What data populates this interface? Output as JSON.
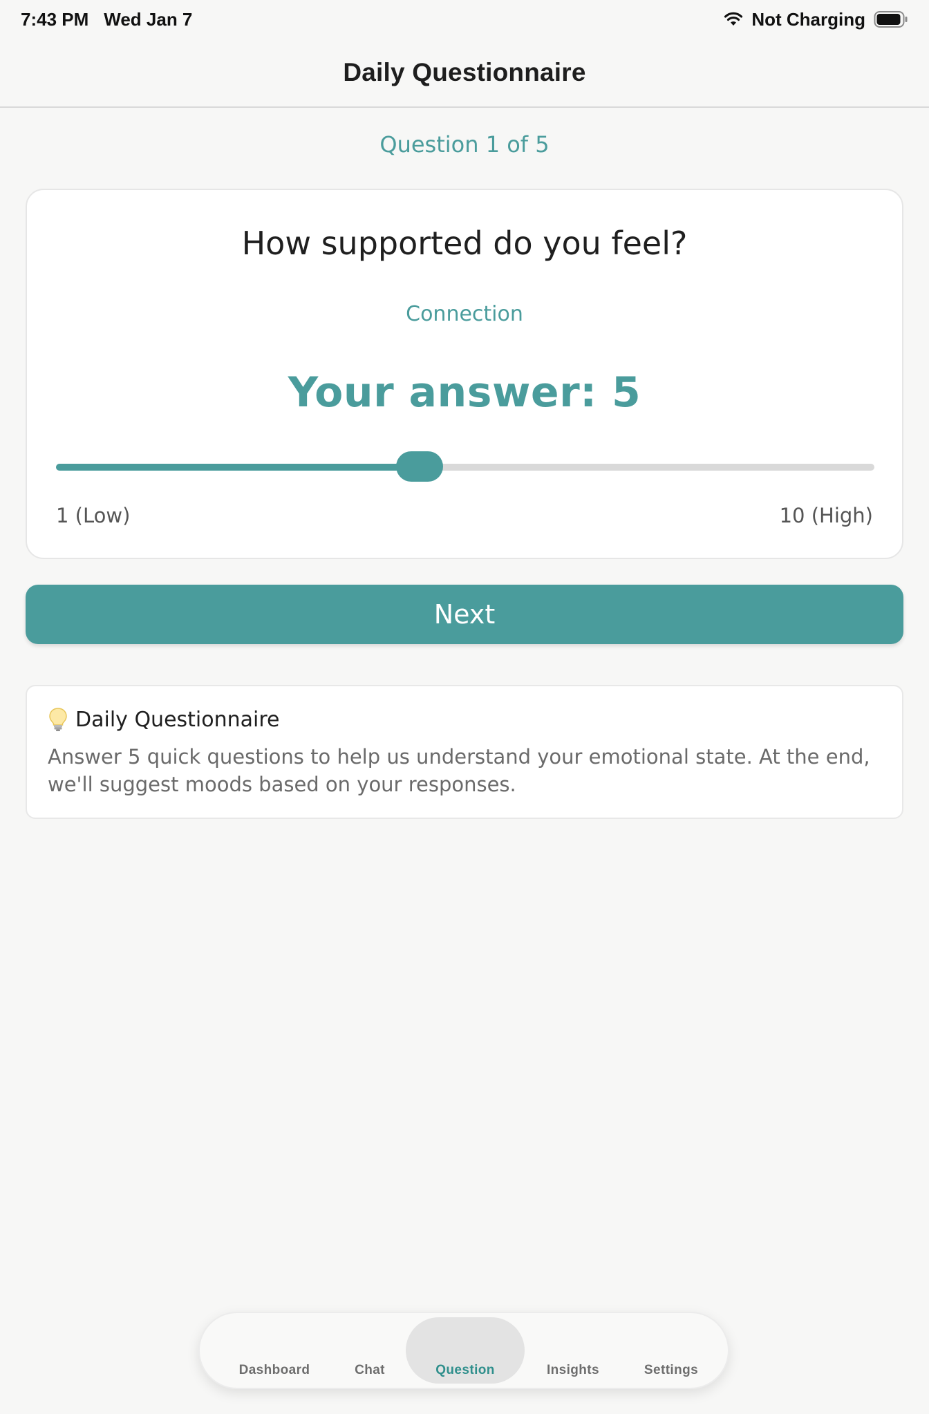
{
  "status_bar": {
    "time": "7:43 PM",
    "date": "Wed Jan 7",
    "charging": "Not Charging"
  },
  "header": {
    "title": "Daily Questionnaire"
  },
  "progress": {
    "text": "Question 1 of 5",
    "current": 1,
    "total": 5
  },
  "question": {
    "title": "How supported do you feel?",
    "category": "Connection",
    "answer_label": "Your answer: 5",
    "slider": {
      "min": 1,
      "max": 10,
      "value": 5
    },
    "min_label": "1 (Low)",
    "max_label": "10 (High)"
  },
  "next_button": {
    "label": "Next"
  },
  "info": {
    "icon": "lightbulb-icon",
    "title": "Daily Questionnaire",
    "text": "Answer 5 quick questions to help us understand your emotional state. At the end, we'll suggest moods based on your responses."
  },
  "tabs": [
    {
      "label": "Dashboard",
      "active": false
    },
    {
      "label": "Chat",
      "active": false
    },
    {
      "label": "Question",
      "active": true
    },
    {
      "label": "Insights",
      "active": false
    },
    {
      "label": "Settings",
      "active": false
    }
  ],
  "colors": {
    "accent": "#4a9c9c",
    "track": "#d9d9d9",
    "background": "#f7f7f6"
  }
}
